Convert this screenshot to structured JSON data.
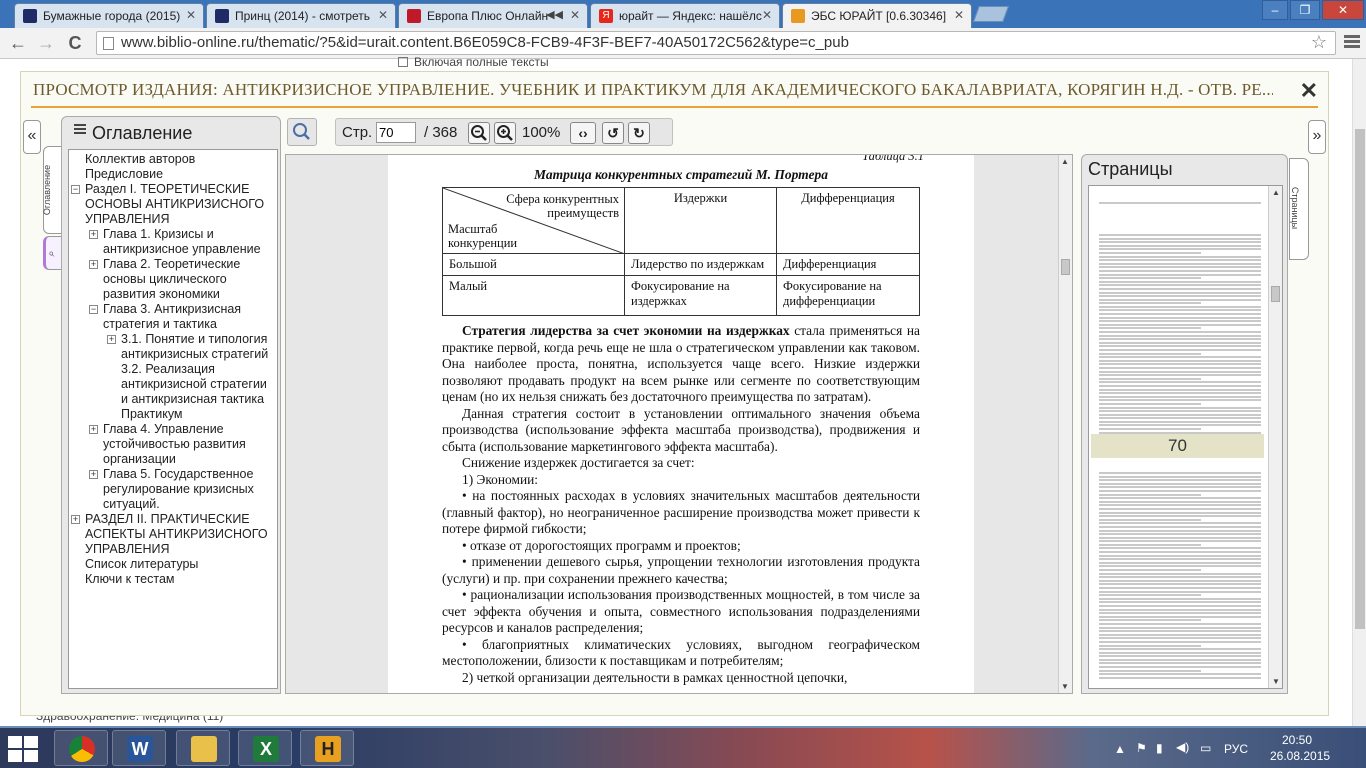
{
  "browser": {
    "tabs": [
      {
        "title": "Бумажные города (2015)",
        "fav_color": "#1e2b66",
        "active": false
      },
      {
        "title": "Принц (2014) - смотреть",
        "fav_color": "#1e2b66",
        "active": false
      },
      {
        "title": "Европа Плюс Онлайн",
        "fav_color": "#c01a2a",
        "active": false,
        "sound": "◀◀"
      },
      {
        "title": "юрайт — Яндекс: нашёлс",
        "fav_color": "#e8261a",
        "fav_letter": "Я",
        "active": false
      },
      {
        "title": "ЭБС ЮРАЙТ [0.6.30346]",
        "fav_color": "#e89a20",
        "active": true
      }
    ],
    "url": "www.biblio-online.ru/thematic/?5&id=urait.content.B6E059C8-FCB9-4F3F-BEF7-40A50172C562&type=c_pub",
    "window_controls": [
      "–",
      "❐",
      "✕"
    ],
    "nav": {
      "back": "←",
      "forward": "→",
      "reload": "C"
    }
  },
  "page_behind": {
    "checkbox_label": "Включая полные тексты",
    "bottom_snippet": "Здравоохранение. Медицина (11)"
  },
  "viewer": {
    "title": "ПРОСМОТР ИЗДАНИЯ: АНТИКРИЗИСНОЕ УПРАВЛЕНИЕ. УЧЕБНИК И ПРАКТИКУМ ДЛЯ АКАДЕМИЧЕСКОГО БАКАЛАВРИАТА, КОРЯГИН Н.Д. - ОТВ. РЕ...",
    "close": "✕",
    "left_arrow": "«",
    "right_arrow": "»",
    "toc_tab_label": "Оглавление",
    "pages_tab_label": "Страницы",
    "toc": {
      "heading": "Оглавление",
      "items": [
        {
          "text": "Коллектив авторов",
          "indent": 0,
          "exp": ""
        },
        {
          "text": "Предисловие",
          "indent": 0,
          "exp": ""
        },
        {
          "text": "Раздел I. ТЕОРЕТИЧЕСКИЕ ОСНОВЫ АНТИКРИЗИСНОГО УПРАВЛЕНИЯ",
          "indent": 0,
          "exp": "−"
        },
        {
          "text": "Глава 1. Кризисы и антикризисное управление",
          "indent": 1,
          "exp": "+"
        },
        {
          "text": "Глава 2. Теоретические основы циклического развития экономики",
          "indent": 1,
          "exp": "+"
        },
        {
          "text": "Глава 3. Антикризисная стратегия и тактика",
          "indent": 1,
          "exp": "−"
        },
        {
          "text": "3.1. Понятие и типология антикризисных стратегий",
          "indent": 2,
          "exp": "+"
        },
        {
          "text": "3.2. Реализация антикризисной стратегии и антикризисная тактика",
          "indent": 2,
          "exp": ""
        },
        {
          "text": "Практикум",
          "indent": 2,
          "exp": ""
        },
        {
          "text": "Глава 4. Управление устойчивостью развития организации",
          "indent": 1,
          "exp": "+"
        },
        {
          "text": "Глава 5. Государственное регулирование кризисных ситуаций.",
          "indent": 1,
          "exp": "+"
        },
        {
          "text": "РАЗДЕЛ II. ПРАКТИЧЕСКИЕ АСПЕКТЫ АНТИКРИЗИСНОГО УПРАВЛЕНИЯ",
          "indent": 0,
          "exp": "+"
        },
        {
          "text": "Список литературы",
          "indent": 0,
          "exp": ""
        },
        {
          "text": "Ключи к тестам",
          "indent": 0,
          "exp": ""
        }
      ]
    },
    "toolbar": {
      "page_label": "Стр.",
      "page_value": "70",
      "page_total": "/ 368",
      "zoom": "100%",
      "zoom_out": "−",
      "zoom_in": "+",
      "fit": "‹›",
      "rotate_left": "↺",
      "rotate_right": "↻"
    },
    "document": {
      "table_number": "Таблица 3.1",
      "matrix_title": "Матрица конкурентных стратегий М. Портера",
      "header_diag_top": "Сфера конкурентных преимуществ",
      "header_diag_bottom": "Масштаб конкуренции",
      "col1": "Издержки",
      "col2": "Дифференциация",
      "row1": {
        "label": "Большой",
        "c1": "Лидерство по издержкам",
        "c2": "Дифференциация"
      },
      "row2": {
        "label": "Малый",
        "c1": "Фокусирование на издержках",
        "c2": "Фокусирование на дифференциации"
      },
      "p1_bold": "Стратегия лидерства за счет экономии на издержках",
      "p1": " стала приме­няться на практике первой, когда речь еще не шла о стратегическом управ­лении как таковом. Она наиболее проста, понятна, используется чаще всего. Низкие издержки позволяют продавать продукт на всем рынке или сегменте по соответствующим ценам (но их нельзя снижать без достаточ­ного преимущества по затратам).",
      "p2": "Данная стратегия состоит в установлении оптимального значения объ­ема производства (использование эффекта масштаба производства), про­движения и сбыта (использование маркетингового эффекта масштаба).",
      "p3": "Снижение издержек достигается за счет:",
      "p4": "1) Экономии:",
      "b1": "•   на постоянных расходах в условиях значительных масштабов дея­тельности (главный фактор), но неограниченное расширение производства может привести к потере фирмой гибкости;",
      "b2": "•   отказе от дорогостоящих программ и проектов;",
      "b3": "•   применении дешевого сырья, упрощении технологии изготовления продукта (услуги) и пр. при сохранении прежнего качества;",
      "b4": "•   рационализации использования производственных мощностей, в том числе за счет эффекта обучения и опыта, совместного использования под­разделениями ресурсов и каналов распределения;",
      "b5": "•   благоприятных климатических условиях, выгодном географическом местоположении, близости к поставщикам и потребителям;",
      "p5": "2) четкой организации деятельности в рамках ценностной цепочки,"
    },
    "pages_panel": {
      "heading": "Страницы",
      "current_page": "70"
    }
  },
  "taskbar": {
    "apps": [
      {
        "name": "chrome",
        "letter": "",
        "color": "#d33"
      },
      {
        "name": "word",
        "letter": "W",
        "color": "#2a5699"
      },
      {
        "name": "explorer",
        "letter": "",
        "color": "#e9c04a"
      },
      {
        "name": "excel",
        "letter": "X",
        "color": "#1f7a3c"
      },
      {
        "name": "h-app",
        "letter": "H",
        "color": "#e8a020"
      }
    ],
    "lang": "РУС",
    "time": "20:50",
    "date": "26.08.2015"
  }
}
